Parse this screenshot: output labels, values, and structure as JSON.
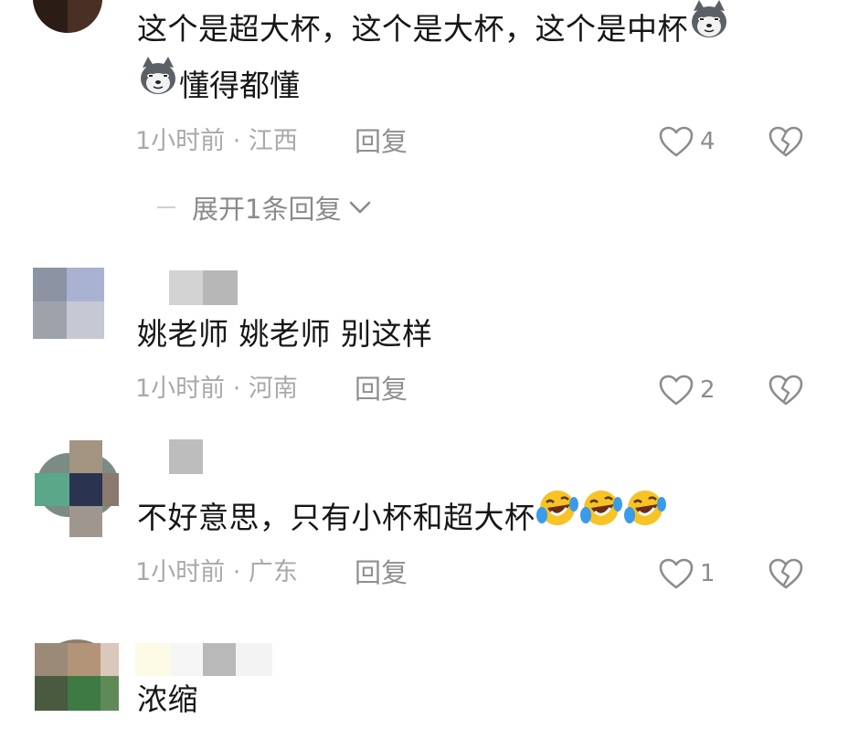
{
  "comments": [
    {
      "text_line1": "这个是超大杯，这个是大杯，这个是中杯",
      "text_line2": "懂得都懂",
      "time_location": "1小时前 · 江西",
      "reply_label": "回复",
      "like_count": "4",
      "emojis_line1": [
        "husky-dog-emoji"
      ],
      "emojis_line2_prefix": [
        "husky-dog-emoji"
      ]
    },
    {
      "text_line1": "姚老师 姚老师 别这样",
      "time_location": "1小时前 · 河南",
      "reply_label": "回复",
      "like_count": "2"
    },
    {
      "text_line1": "不好意思，只有小杯和超大杯",
      "time_location": "1小时前 · 广东",
      "reply_label": "回复",
      "like_count": "1",
      "emojis_trailing": [
        "laugh-cry-emoji",
        "laugh-cry-emoji",
        "laugh-cry-emoji"
      ]
    },
    {
      "text_line1": "浓缩"
    }
  ],
  "expand_replies_label": "展开1条回复",
  "icons": {
    "like": "heart-outline-icon",
    "dislike": "broken-heart-icon",
    "expand": "chevron-down-icon"
  },
  "colors": {
    "text": "#161616",
    "meta": "#a9a9a9",
    "action": "#8c8c8c",
    "emoji_yellow": "#f7c325",
    "emoji_tears": "#3a9bea"
  }
}
